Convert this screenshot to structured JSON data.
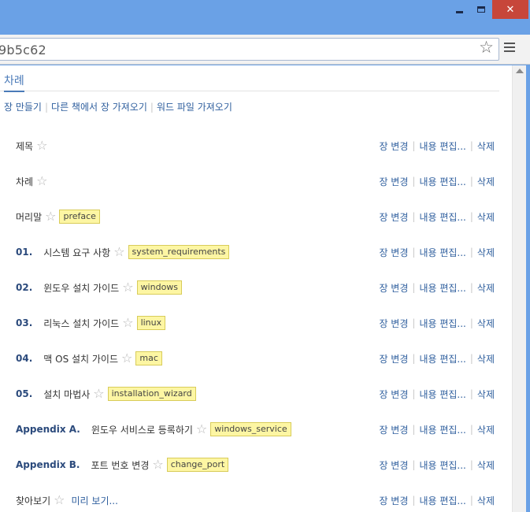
{
  "window": {
    "close_glyph": "✕"
  },
  "address_bar": {
    "url": "9b5c62",
    "bookmark_icon": "star-outline-icon",
    "menu_icon": "hamburger-menu-icon"
  },
  "tabs": [
    {
      "label": "차례",
      "active": true
    }
  ],
  "actions": {
    "new_chapter": "장 만들기",
    "import_from_book": "다른 책에서 장 가져오기",
    "import_word": "워드 파일 가져오기"
  },
  "row_actions": {
    "change": "장 변경",
    "edit": "내용 편집...",
    "delete": "삭제"
  },
  "chapters": [
    {
      "number": "",
      "title": "제목",
      "tag": ""
    },
    {
      "number": "",
      "title": "차례",
      "tag": ""
    },
    {
      "number": "",
      "title": "머리말",
      "tag": "preface"
    },
    {
      "number": "01.",
      "title": "시스템 요구 사항",
      "tag": "system_requirements"
    },
    {
      "number": "02.",
      "title": "윈도우 설치 가이드",
      "tag": "windows"
    },
    {
      "number": "03.",
      "title": "리눅스 설치 가이드",
      "tag": "linux"
    },
    {
      "number": "04.",
      "title": "맥 OS 설치 가이드",
      "tag": "mac"
    },
    {
      "number": "05.",
      "title": "설치 마법사",
      "tag": "installation_wizard"
    },
    {
      "number": "Appendix A.",
      "title": "윈도우 서비스로 등록하기",
      "tag": "windows_service"
    },
    {
      "number": "Appendix B.",
      "title": "포트 번호 변경",
      "tag": "change_port"
    },
    {
      "number": "",
      "title": "찾아보기",
      "tag": "",
      "preview": "미리 보기..."
    }
  ],
  "colors": {
    "frame": "#6aa1e6",
    "link": "#2f5f9e",
    "tag_bg": "#fdf6a3",
    "close_button": "#c7463a"
  }
}
